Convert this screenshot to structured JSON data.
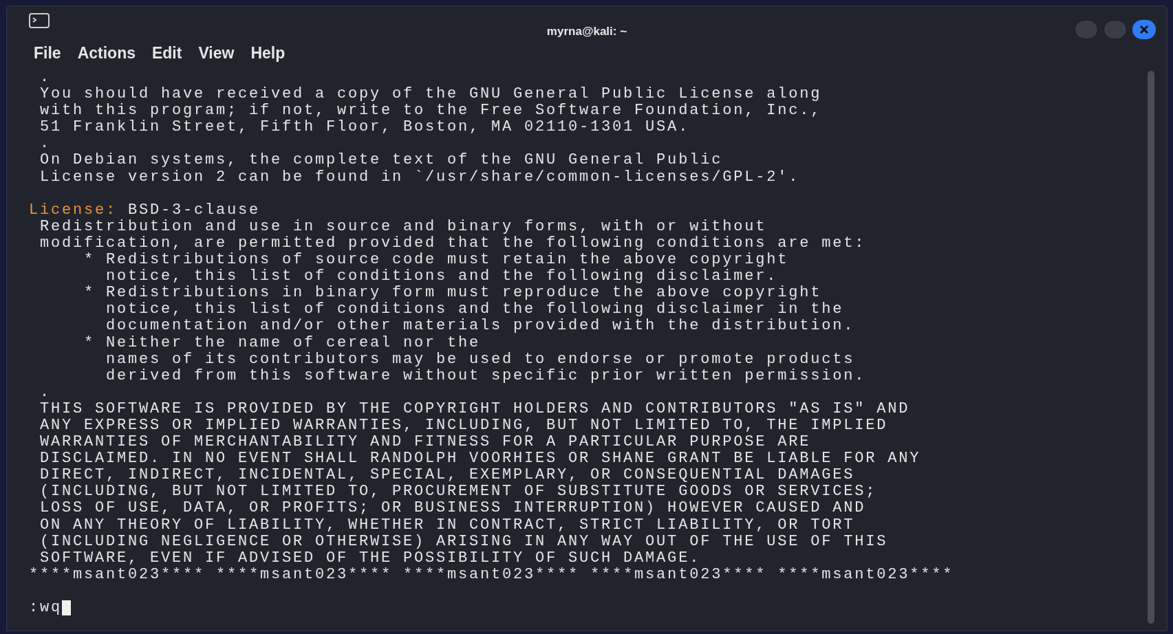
{
  "window": {
    "title": "myrna@kali: ~"
  },
  "menu": [
    "File",
    "Actions",
    "Edit",
    "View",
    "Help"
  ],
  "terminal_lines": [
    {
      "kind": "text",
      "text": " ."
    },
    {
      "kind": "text",
      "text": " You should have received a copy of the GNU General Public License along"
    },
    {
      "kind": "text",
      "text": " with this program; if not, write to the Free Software Foundation, Inc.,"
    },
    {
      "kind": "text",
      "text": " 51 Franklin Street, Fifth Floor, Boston, MA 02110-1301 USA."
    },
    {
      "kind": "text",
      "text": " ."
    },
    {
      "kind": "text",
      "text": " On Debian systems, the complete text of the GNU General Public"
    },
    {
      "kind": "text",
      "text": " License version 2 can be found in `/usr/share/common-licenses/GPL-2'."
    },
    {
      "kind": "blank"
    },
    {
      "kind": "labeled",
      "label": "License:",
      "text": " BSD-3-clause"
    },
    {
      "kind": "text",
      "text": " Redistribution and use in source and binary forms, with or without"
    },
    {
      "kind": "text",
      "text": " modification, are permitted provided that the following conditions are met:"
    },
    {
      "kind": "text",
      "text": "     * Redistributions of source code must retain the above copyright"
    },
    {
      "kind": "text",
      "text": "       notice, this list of conditions and the following disclaimer."
    },
    {
      "kind": "text",
      "text": "     * Redistributions in binary form must reproduce the above copyright"
    },
    {
      "kind": "text",
      "text": "       notice, this list of conditions and the following disclaimer in the"
    },
    {
      "kind": "text",
      "text": "       documentation and/or other materials provided with the distribution."
    },
    {
      "kind": "text",
      "text": "     * Neither the name of cereal nor the"
    },
    {
      "kind": "text",
      "text": "       names of its contributors may be used to endorse or promote products"
    },
    {
      "kind": "text",
      "text": "       derived from this software without specific prior written permission."
    },
    {
      "kind": "text",
      "text": " ."
    },
    {
      "kind": "text",
      "text": " THIS SOFTWARE IS PROVIDED BY THE COPYRIGHT HOLDERS AND CONTRIBUTORS \"AS IS\" AND"
    },
    {
      "kind": "text",
      "text": " ANY EXPRESS OR IMPLIED WARRANTIES, INCLUDING, BUT NOT LIMITED TO, THE IMPLIED"
    },
    {
      "kind": "text",
      "text": " WARRANTIES OF MERCHANTABILITY AND FITNESS FOR A PARTICULAR PURPOSE ARE"
    },
    {
      "kind": "text",
      "text": " DISCLAIMED. IN NO EVENT SHALL RANDOLPH VOORHIES OR SHANE GRANT BE LIABLE FOR ANY"
    },
    {
      "kind": "text",
      "text": " DIRECT, INDIRECT, INCIDENTAL, SPECIAL, EXEMPLARY, OR CONSEQUENTIAL DAMAGES"
    },
    {
      "kind": "text",
      "text": " (INCLUDING, BUT NOT LIMITED TO, PROCUREMENT OF SUBSTITUTE GOODS OR SERVICES;"
    },
    {
      "kind": "text",
      "text": " LOSS OF USE, DATA, OR PROFITS; OR BUSINESS INTERRUPTION) HOWEVER CAUSED AND"
    },
    {
      "kind": "text",
      "text": " ON ANY THEORY OF LIABILITY, WHETHER IN CONTRACT, STRICT LIABILITY, OR TORT"
    },
    {
      "kind": "text",
      "text": " (INCLUDING NEGLIGENCE OR OTHERWISE) ARISING IN ANY WAY OUT OF THE USE OF THIS"
    },
    {
      "kind": "text",
      "text": " SOFTWARE, EVEN IF ADVISED OF THE POSSIBILITY OF SUCH DAMAGE."
    },
    {
      "kind": "text",
      "text": "****msant023**** ****msant023**** ****msant023**** ****msant023**** ****msant023****"
    },
    {
      "kind": "blank"
    },
    {
      "kind": "prompt",
      "text": ":wq"
    }
  ]
}
